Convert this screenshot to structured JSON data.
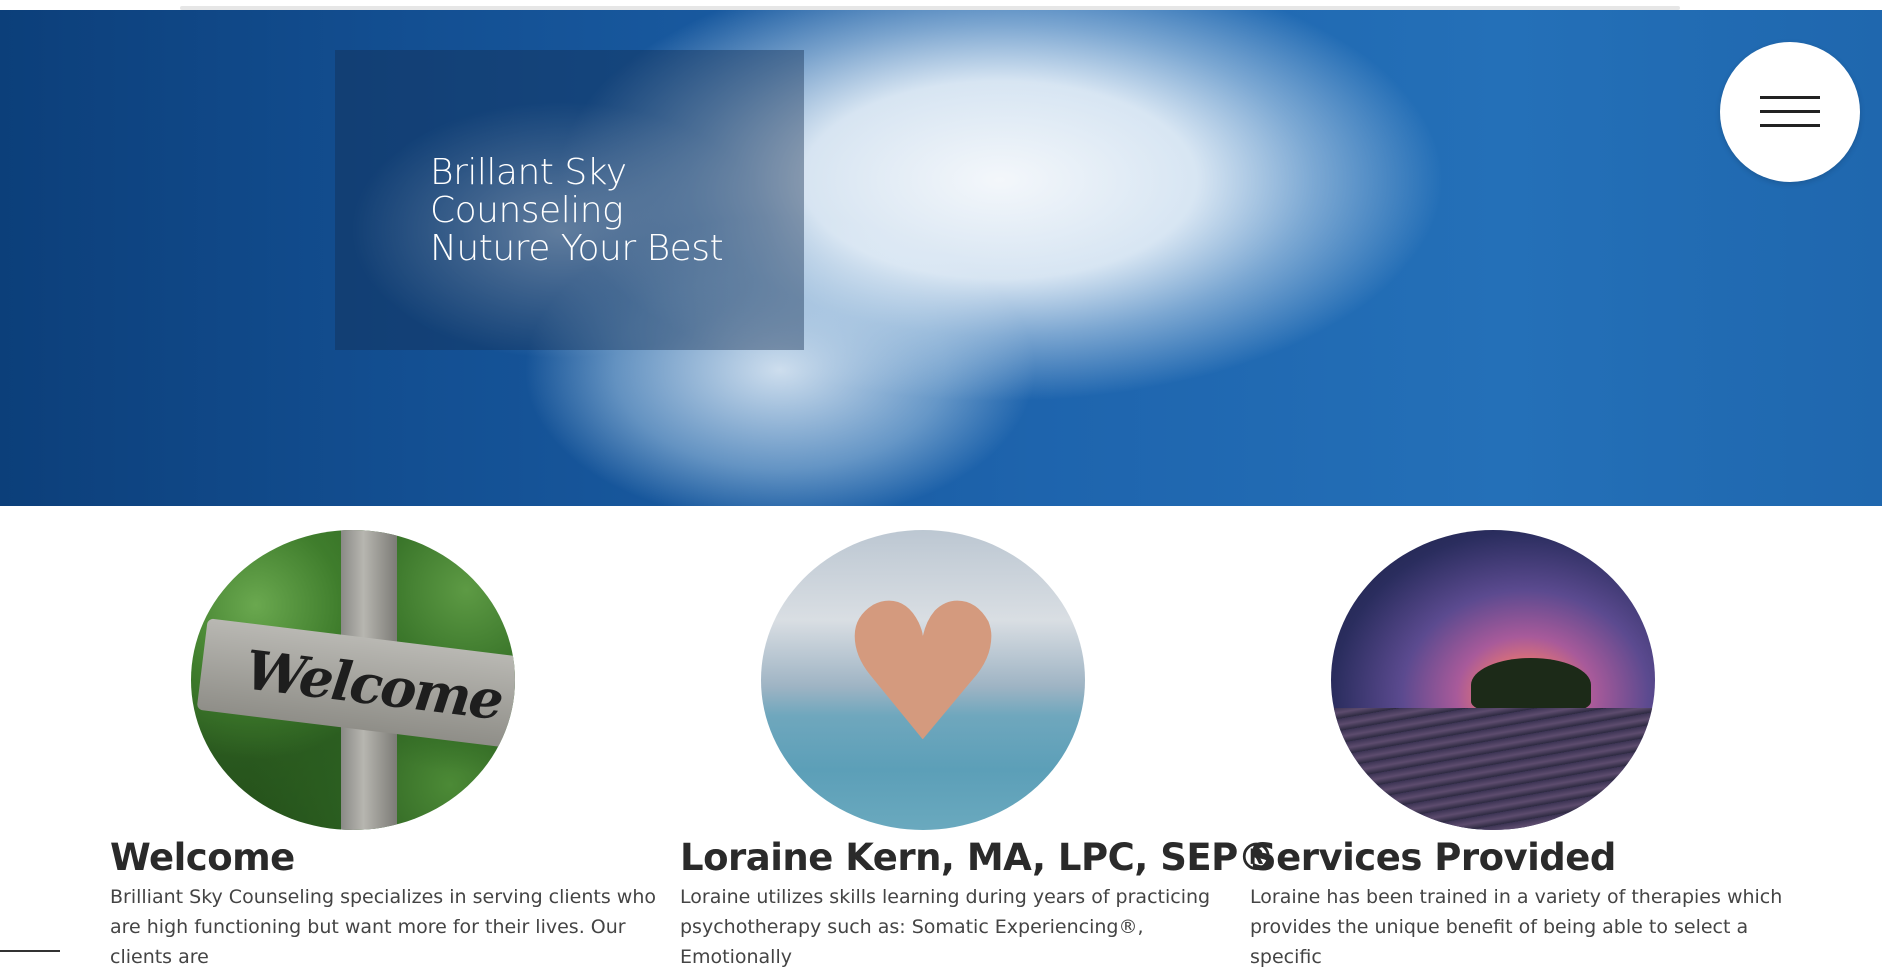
{
  "hero": {
    "title_lines": [
      "Brillant Sky",
      "Counseling",
      "Nuture Your Best"
    ]
  },
  "menu": {
    "icon": "hamburger-icon"
  },
  "cards": [
    {
      "image": "welcome-sign-photo",
      "title": "Welcome",
      "text": "Brilliant Sky Counseling specializes in serving clients who are high functioning but want more for their lives. Our clients are"
    },
    {
      "image": "heart-hands-photo",
      "title": "Loraine Kern, MA, LPC, SEP®",
      "text": "Loraine utilizes skills learning during years of practicing psychotherapy such as: Somatic Experiencing®, Emotionally"
    },
    {
      "image": "sunset-tree-photo",
      "title": "Services Provided",
      "text": "Loraine has been trained in a variety of therapies which provides the unique benefit of being able to select a specific"
    }
  ]
}
